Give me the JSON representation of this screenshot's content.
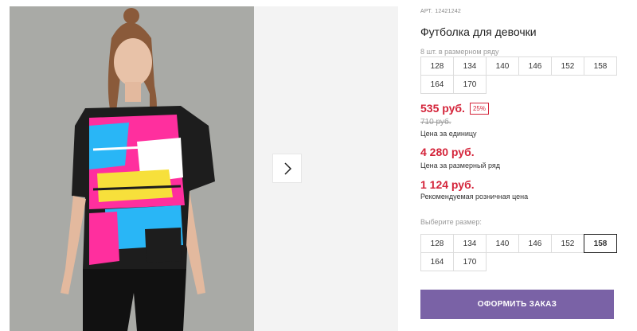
{
  "gallery": {
    "next_arrow_icon": "chevron-right-icon",
    "photo_bg": "#a9aaa6"
  },
  "product": {
    "art_label": "АРТ.",
    "art_number": "12421242",
    "title": "Футболка для девочки",
    "size_note": "8 шт. в размерном ряду",
    "set_sizes": [
      "128",
      "134",
      "140",
      "146",
      "152",
      "158",
      "164",
      "170"
    ],
    "price_current": "535 руб.",
    "discount": "25%",
    "price_old": "710 руб.",
    "price_unit_caption": "Цена за единицу",
    "price_set": "4 280 руб.",
    "price_set_caption": "Цена за размерный ряд",
    "price_retail": "1 124 руб.",
    "price_retail_caption": "Рекомендуемая розничная цена",
    "choose_size_label": "Выберите размер:",
    "size_options": [
      "128",
      "134",
      "140",
      "146",
      "152",
      "158",
      "164",
      "170"
    ],
    "selected_size": "158"
  },
  "actions": {
    "order_button": "ОФОРМИТЬ ЗАКАЗ"
  },
  "colors": {
    "accent_purple": "#7a62a6",
    "price_red": "#d4243a"
  }
}
